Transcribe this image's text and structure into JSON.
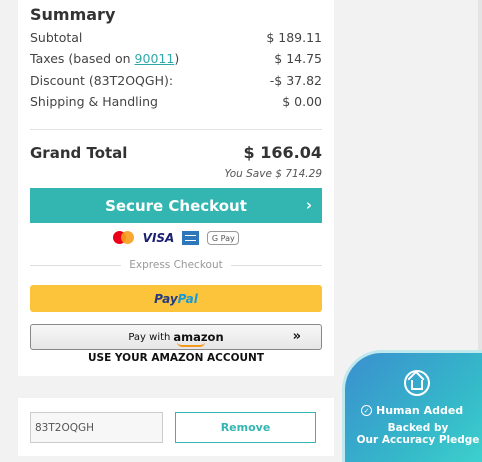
{
  "summary": {
    "title": "Summary",
    "rows": [
      {
        "label": "Subtotal",
        "amount": "$ 189.11"
      },
      {
        "label_prefix": "Taxes (based on ",
        "zip": "90011",
        "label_suffix": ")",
        "amount": "$ 14.75"
      },
      {
        "label": "Discount (83T2OQGH):",
        "amount": "-$ 37.82"
      },
      {
        "label": "Shipping & Handling",
        "amount": "$ 0.00"
      }
    ],
    "grand_total_label": "Grand Total",
    "grand_total_amount": "$ 166.04",
    "you_save": "You Save $ 714.29"
  },
  "checkout": {
    "button_label": "Secure Checkout",
    "chevron": "›",
    "payment_icons": [
      "mastercard-icon",
      "visa-icon",
      "amex-icon",
      "google-pay-icon"
    ],
    "visa_text": "VISA",
    "gpay_text": "G Pay",
    "express_label": "Express Checkout",
    "paypal_part1": "Pay",
    "paypal_part2": "Pal",
    "amazon_prefix": "Pay with",
    "amazon_logo": "amazon",
    "amazon_arrows": "»",
    "amazon_note": "USE YOUR AMAZON ACCOUNT"
  },
  "promo": {
    "code_value": "83T2OQGH",
    "remove_label": "Remove"
  },
  "badge": {
    "title": "Human Added",
    "line1": "Backed by",
    "line2": "Our Accuracy Pledge"
  },
  "colors": {
    "accent": "#33b5b1",
    "paypal_yellow": "#fcc43a",
    "badge_blue": "#3a8fcf"
  }
}
